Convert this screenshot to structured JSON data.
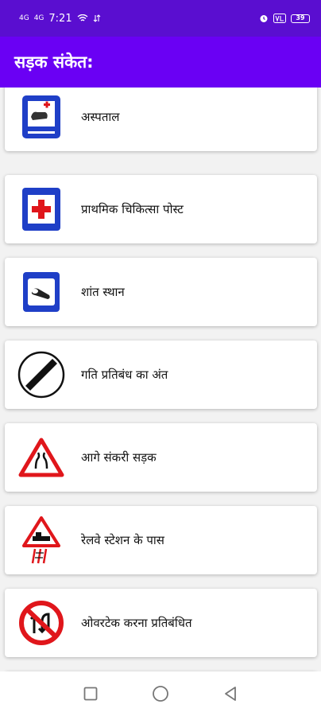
{
  "status": {
    "time": "7:21",
    "signal1": "4G",
    "signal2": "4G",
    "battery": "39"
  },
  "appbar": {
    "title": "सड़क संकेत:"
  },
  "signs": [
    {
      "label": "अस्पताल",
      "icon": "hospital-sign-icon"
    },
    {
      "label": "प्राथमिक चिकित्सा पोस्ट",
      "icon": "first-aid-sign-icon"
    },
    {
      "label": "शांत स्थान",
      "icon": "quiet-zone-sign-icon"
    },
    {
      "label": "गति प्रतिबंध का अंत",
      "icon": "end-speed-limit-sign-icon"
    },
    {
      "label": "आगे संकरी सड़क",
      "icon": "narrow-road-sign-icon"
    },
    {
      "label": "रेलवे स्टेशन के पास",
      "icon": "railway-station-sign-icon"
    },
    {
      "label": "ओवरटेक करना प्रतिबंधित",
      "icon": "no-overtaking-sign-icon"
    }
  ],
  "colors": {
    "statusbar": "#5a0ed0",
    "appbar": "#6a00f4",
    "signBlue": "#1f3fc7",
    "signRed": "#e0161b"
  }
}
